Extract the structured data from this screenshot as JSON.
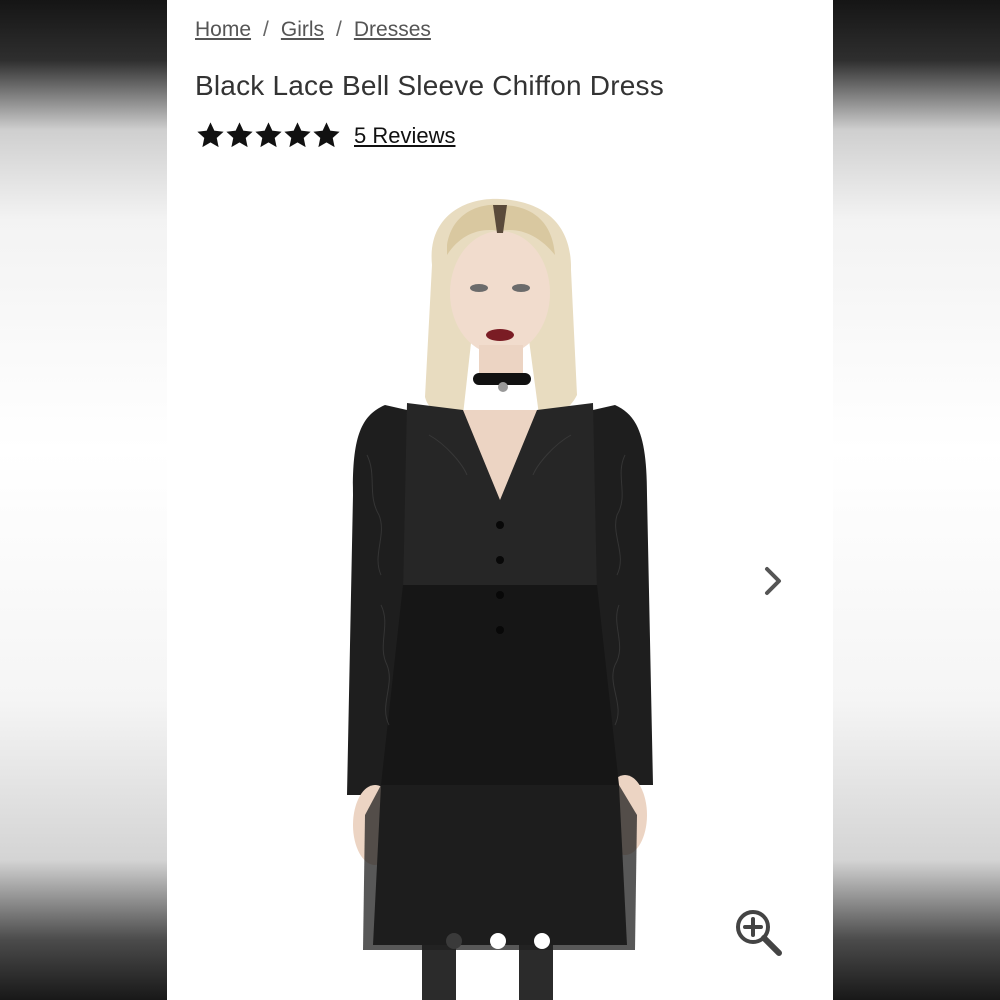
{
  "breadcrumb": {
    "items": [
      {
        "label": "Home"
      },
      {
        "label": "Girls"
      },
      {
        "label": "Dresses"
      }
    ],
    "separator": "/"
  },
  "product": {
    "title": "Black Lace Bell Sleeve Chiffon Dress",
    "rating": 5,
    "rating_max": 5,
    "reviews_label": "5 Reviews"
  },
  "gallery": {
    "image_count": 3,
    "current_index": 0,
    "next_icon": "chevron-right-icon",
    "zoom_icon": "zoom-in-icon"
  },
  "colors": {
    "star": "#111111",
    "text": "#333333",
    "link": "#555555"
  }
}
